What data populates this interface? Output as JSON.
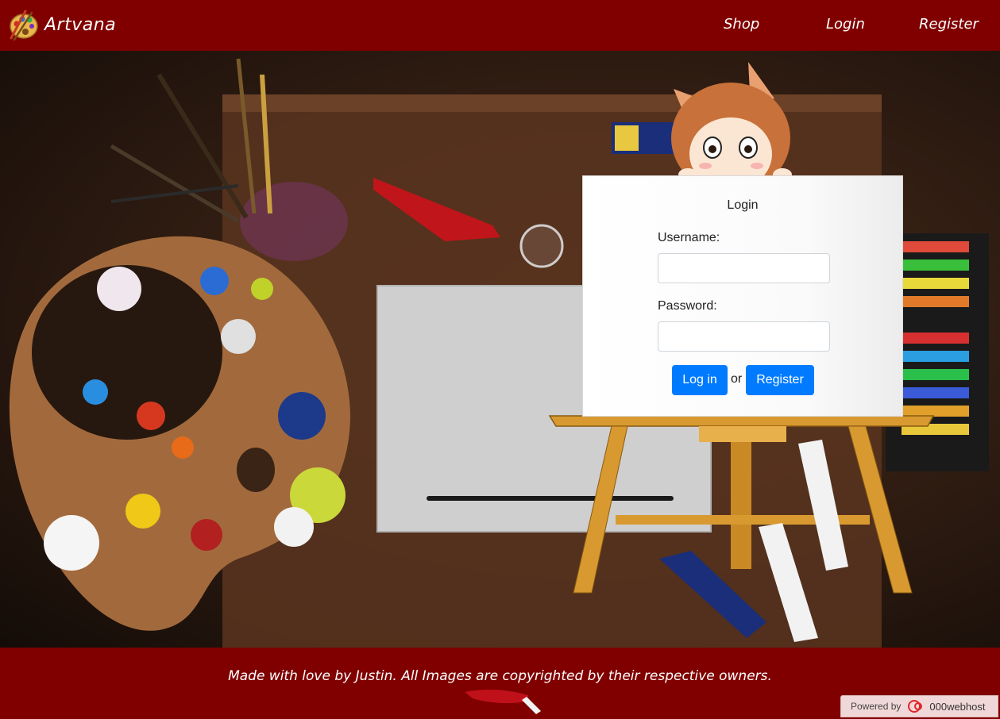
{
  "header": {
    "brand": "Artvana",
    "nav": {
      "shop": "Shop",
      "login": "Login",
      "register": "Register"
    }
  },
  "login": {
    "title": "Login",
    "username_label": "Username:",
    "username_value": "",
    "password_label": "Password:",
    "password_value": "",
    "login_button": "Log in",
    "or_text": "or",
    "register_button": "Register"
  },
  "footer": {
    "text": "Made with love by Justin. All Images are copyrighted by their respective owners.",
    "powered_by": "Powered by",
    "host": "000webhost"
  },
  "colors": {
    "brand": "#800000",
    "button": "#007bff"
  },
  "icons": {
    "logo": "palette-icon",
    "host_logo": "000webhost-icon"
  }
}
